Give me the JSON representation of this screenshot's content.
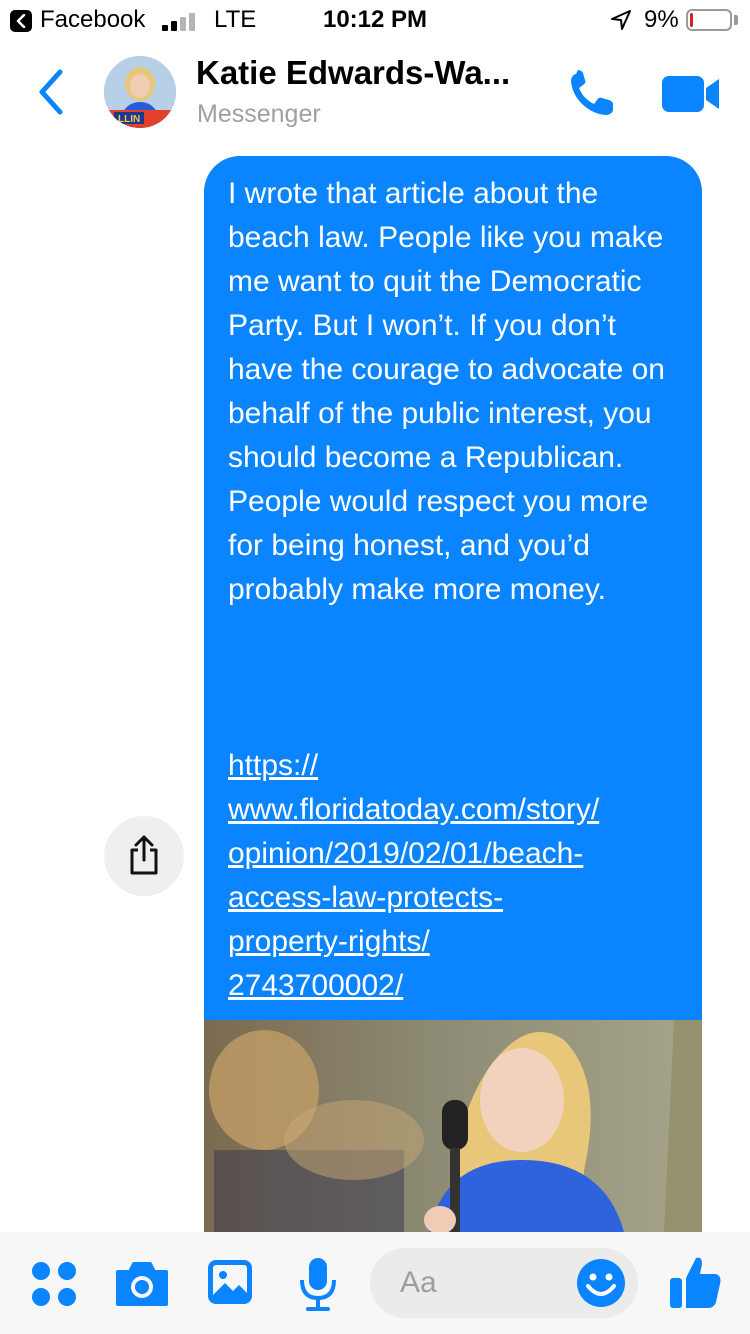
{
  "status_bar": {
    "back_app": "Facebook",
    "network": "LTE",
    "time": "10:12 PM",
    "battery": "9%",
    "battery_level": 0.09
  },
  "header": {
    "contact_name": "Katie Edwards-Wa...",
    "subtitle": "Messenger",
    "avatar_text": "LLIN"
  },
  "message": {
    "text": "I wrote that article about the beach law. People like you make me want to quit the Democratic Party. But I won’t. If you don’t have the courage to advocate on behalf of the public interest, you should become a Republican. People would respect you more for being honest, and you’d probably make more money.",
    "link": "https://\nwww.floridatoday.com/story/\nopinion/2019/02/01/beach-\naccess-law-protects-\nproperty-rights/\n2743700002/"
  },
  "composer": {
    "placeholder": "Aa"
  },
  "colors": {
    "accent": "#0a84ff",
    "bubble": "#0a84ff",
    "battery_low": "#e02020"
  },
  "icons": [
    "back-arrow-icon",
    "phone-icon",
    "video-camera-icon",
    "share-icon",
    "grid-icon",
    "camera-icon",
    "image-icon",
    "microphone-icon",
    "emoji-icon",
    "thumbs-up-icon",
    "location-arrow-icon"
  ]
}
